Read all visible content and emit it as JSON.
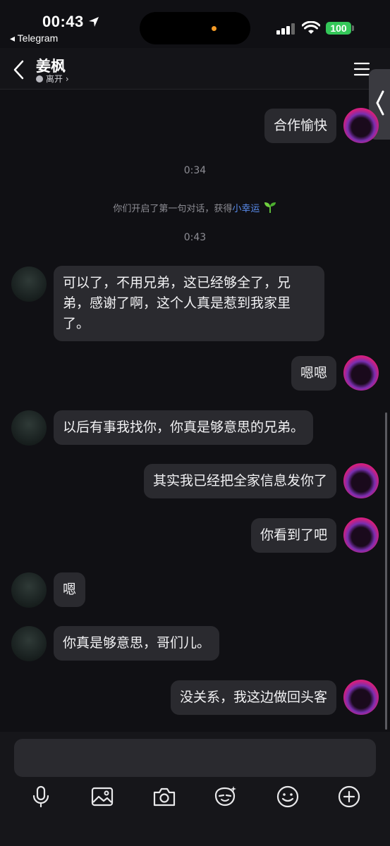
{
  "status_bar": {
    "time": "00:43",
    "back_app": "◂ Telegram",
    "battery": "100"
  },
  "header": {
    "title": "姜枫",
    "status": "离开 ›"
  },
  "chat": {
    "m1": "合作愉快",
    "ts1": "0:34",
    "sys_prefix": "你们开启了第一句对话，获得",
    "sys_highlight": "小幸运",
    "ts2": "0:43",
    "m2": "可以了，不用兄弟，这已经够全了，兄弟，感谢了啊，这个人真是惹到我家里了。",
    "m3": "嗯嗯",
    "m4": "以后有事我找你，你真是够意思的兄弟。",
    "m5": "其实我已经把全家信息发你了",
    "m6": "你看到了吧",
    "m7": "嗯",
    "m8": "你真是够意思，哥们儿。",
    "m9": "没关系，我这边做回头客"
  },
  "composer": {
    "placeholder": ""
  },
  "icons": [
    "mic-icon",
    "image-icon",
    "camera-icon",
    "sticker-icon",
    "emoji-icon",
    "plus-icon"
  ],
  "colors": {
    "accent": "#5a8dee",
    "bubble": "#2a2a2f",
    "background": "#101014"
  }
}
